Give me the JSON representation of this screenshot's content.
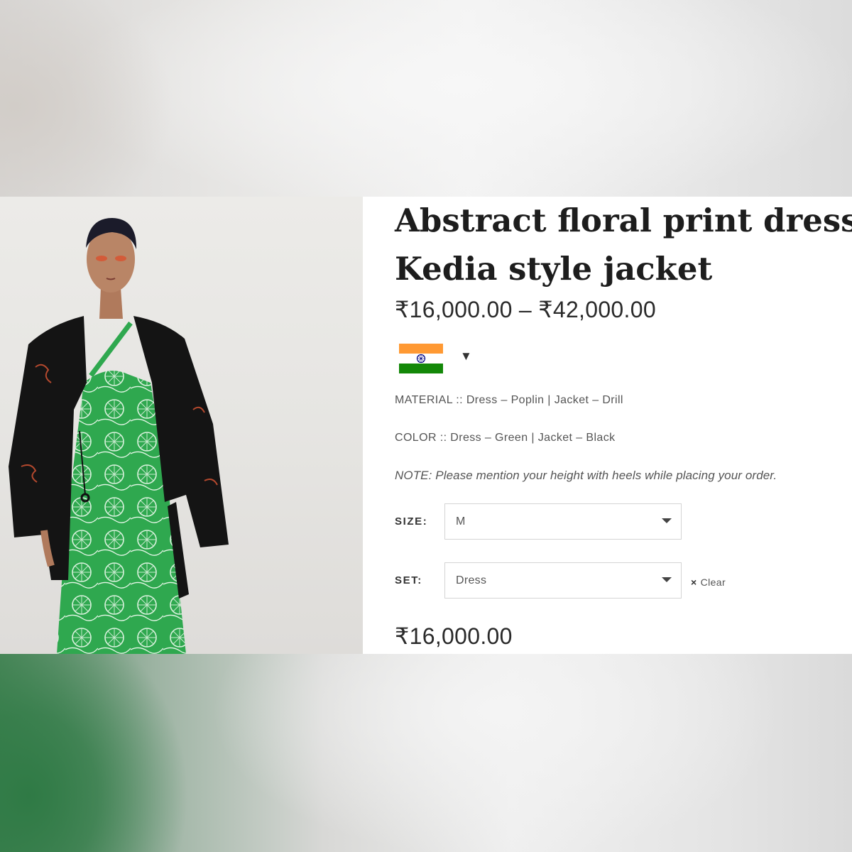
{
  "product": {
    "title_line1": "Abstract floral print dress &",
    "title_line2": "Kedia style jacket",
    "price_range": "₹16,000.00 – ₹42,000.00",
    "currency_switcher": {
      "flag": "india-flag-icon",
      "caret": "▼"
    },
    "material": "MATERIAL :: Dress – Poplin | Jacket – Drill",
    "color": "COLOR :: Dress – Green | Jacket – Black",
    "note": "NOTE: Please mention your height with heels while placing your order.",
    "options": {
      "size": {
        "label": "SIZE:",
        "value": "M"
      },
      "set": {
        "label": "SET:",
        "value": "Dress"
      }
    },
    "clear_label": "Clear",
    "clear_icon": "×",
    "selected_price": "₹16,000.00"
  },
  "colors": {
    "saffron": "#ff9933",
    "flag_green": "#138808",
    "chakra": "#000080",
    "dress_green": "#2fa84f",
    "jacket_black": "#141414"
  }
}
